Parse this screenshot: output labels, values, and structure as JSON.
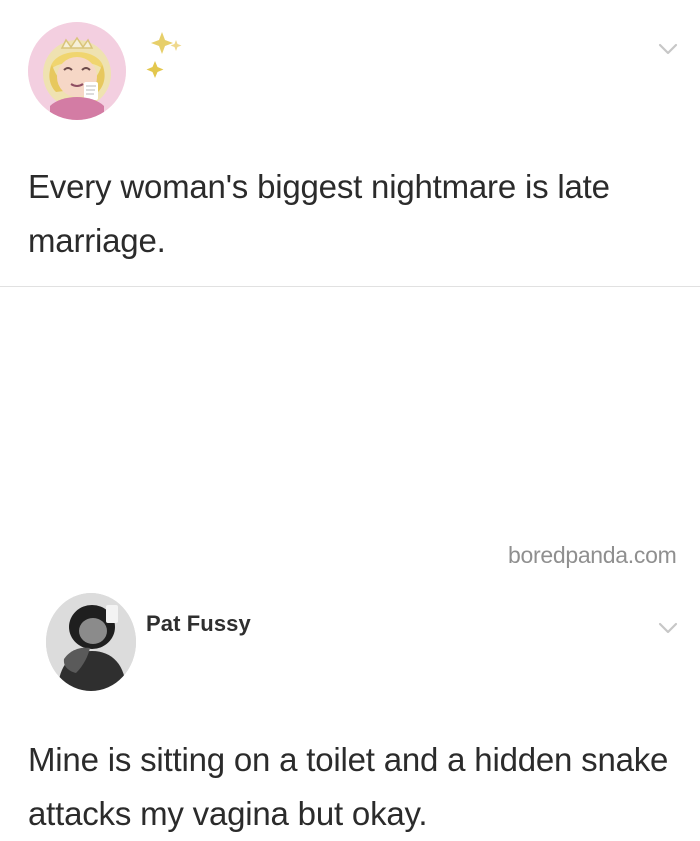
{
  "post1": {
    "text": "Every woman's biggest nightmare is late marriage.",
    "avatar": "cartoon-princess-avatar",
    "decoration": "sparkles-icon",
    "menu_icon": "chevron-down-icon"
  },
  "post2": {
    "username": "Pat Fussy",
    "text": "Mine is sitting on a toilet and a hidden snake attacks my vagina but okay.",
    "avatar": "person-photo-avatar",
    "menu_icon": "chevron-down-icon"
  },
  "watermark": "boredpanda.com",
  "colors": {
    "text": "#2b2b2b",
    "username": "#2f2f2f",
    "chevron": "#c7c7c7",
    "divider": "#e1e1e1",
    "watermark": "#8a8a8a",
    "sparkles": "#e3c74d"
  }
}
